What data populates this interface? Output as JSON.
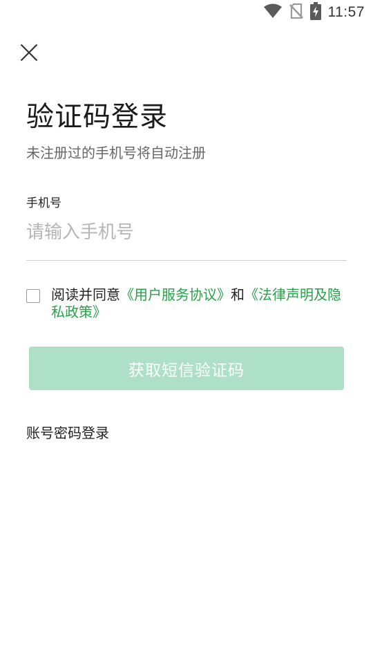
{
  "status_bar": {
    "time": "11:57",
    "icons": [
      "wifi-icon",
      "no-sim-icon",
      "battery-charging-icon"
    ]
  },
  "header": {
    "close_icon": "close-icon",
    "title": "验证码登录",
    "subtitle": "未注册过的手机号将自动注册"
  },
  "phone": {
    "label": "手机号",
    "placeholder": "请输入手机号",
    "value": ""
  },
  "agreement": {
    "checked": false,
    "prefix": "阅读并同意",
    "link1": "《用户服务协议》",
    "conjunction": "和",
    "link2": "《法律声明及隐私政策》"
  },
  "actions": {
    "get_code_label": "获取短信验证码",
    "password_login_label": "账号密码登录"
  },
  "colors": {
    "accent_green": "#26a248",
    "button_disabled": "#aee0c7",
    "underline": "#cfcfcf"
  }
}
